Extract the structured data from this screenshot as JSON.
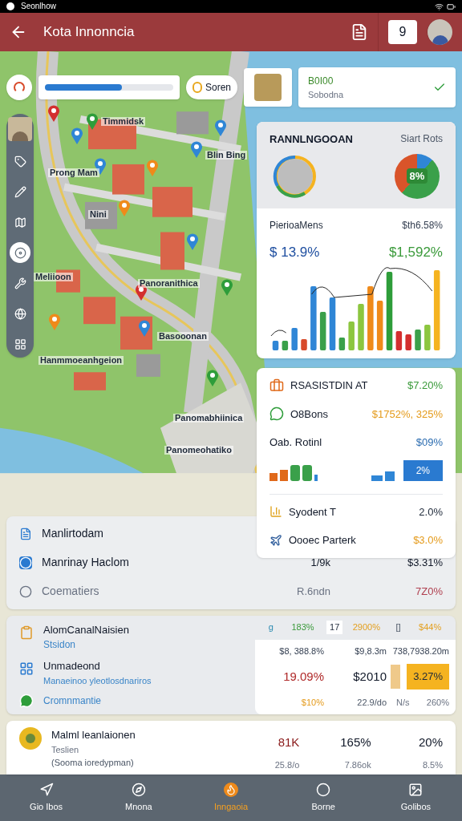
{
  "status_bar": {
    "title": "Seonlhow"
  },
  "header": {
    "title": "Kota Innonncia",
    "badge": "9"
  },
  "map_controls": {
    "progress": {
      "level": 0.6
    },
    "search_chip": "Soren",
    "info_card": {
      "title": "B0I00",
      "subtitle": "Sobodna"
    }
  },
  "toolbar": [
    {
      "kind": "avatar",
      "selected": false
    },
    {
      "kind": "tag",
      "selected": false
    },
    {
      "kind": "pencil",
      "selected": false
    },
    {
      "kind": "map",
      "selected": false
    },
    {
      "kind": "target",
      "selected": true
    },
    {
      "kind": "tool",
      "selected": false
    },
    {
      "kind": "globe",
      "selected": false
    },
    {
      "kind": "grid",
      "selected": false
    }
  ],
  "pins": [
    {
      "color": "#d32f2f"
    },
    {
      "color": "#2e9d3a",
      "label": "Timmidsk"
    },
    {
      "color": "#2f86d6"
    },
    {
      "color": "#2f86d6",
      "label": "Prong Mam"
    },
    {
      "color": "#ef8a1a"
    },
    {
      "color": "#2f86d6",
      "label": "Blin Bing"
    },
    {
      "color": "#2f86d6"
    },
    {
      "color": "#ef8a1a",
      "label": "Nini"
    },
    {
      "color": "#2f86d6"
    },
    {
      "color": "#d32f2f",
      "label": "Panoranithica"
    },
    {
      "color": "#2e9d3a"
    },
    {
      "color": "#ef8a1a"
    },
    {
      "color": "#2f86d6",
      "label": "Basooonan"
    },
    {
      "color": "#2e9d3a",
      "label": "Panomabhiinica"
    }
  ],
  "map_labels": [
    "Meliioon",
    "Hanmmoeanhgeion",
    "Panomeohatiko"
  ],
  "stats_card": {
    "title": "RANNLNGOOAN",
    "side_label": "Siart Rots",
    "pie_label": "8%",
    "subtitle": "PierioaMens",
    "subtitle_value": "$th6.58%",
    "left_value": "$ 13.9%",
    "right_value": "$1,592%"
  },
  "summary_card": {
    "rows": [
      {
        "label": "RSASISTDIN AT",
        "value": "$7.20%"
      },
      {
        "label": "O8Bons",
        "value": "$1752%, 325%"
      },
      {
        "label": "Oab. Rotinl",
        "value": "$09%"
      }
    ],
    "badge": "2%",
    "footer": [
      {
        "label": "Syodent T",
        "value": "2.0%"
      },
      {
        "label": "Oooec Parterk",
        "value": "$3.0%"
      }
    ]
  },
  "panel_1": {
    "rows": [
      {
        "label": "Manlirtodam"
      },
      {
        "label": "Manrinay Haclom",
        "value_1": "1/9k",
        "value_2": "$3.31%"
      },
      {
        "label": "Coematiers",
        "value_1": "R.6ndn",
        "value_2": "7Z0%"
      }
    ]
  },
  "panel_2": {
    "title": "AlomCanalNaisien",
    "subtitle": "Stsidon",
    "item_title": "Unmadeond",
    "item_subtitle": "Manaeinoo yleotlosdnariros",
    "link": "Cromnmantie",
    "header": [
      "g",
      "183%",
      "17",
      "2900%",
      "[]",
      "$44%"
    ],
    "table": [
      [
        "$8, 388.8%",
        "$9,8.3m",
        "738,7938.20m"
      ],
      [
        "19.09%",
        "$2010",
        "3.27%"
      ],
      [
        "$10%",
        "22.9/do",
        "N/s",
        "260%"
      ]
    ]
  },
  "panel_3": {
    "title": "Malml leanlaionen",
    "subtitle": "Teslien",
    "note": "(Sooma ioredypman)",
    "values": [
      "81K",
      "165%",
      "20%"
    ],
    "subvalues": [
      "25.8/o",
      "7.86ok",
      "8.5%"
    ]
  },
  "nav": [
    {
      "label": "Gio Ibos",
      "selected": false
    },
    {
      "label": "Mnona",
      "selected": false
    },
    {
      "label": "Inngaoia",
      "selected": true
    },
    {
      "label": "Borne",
      "selected": false
    },
    {
      "label": "Golibos",
      "selected": false
    }
  ]
}
